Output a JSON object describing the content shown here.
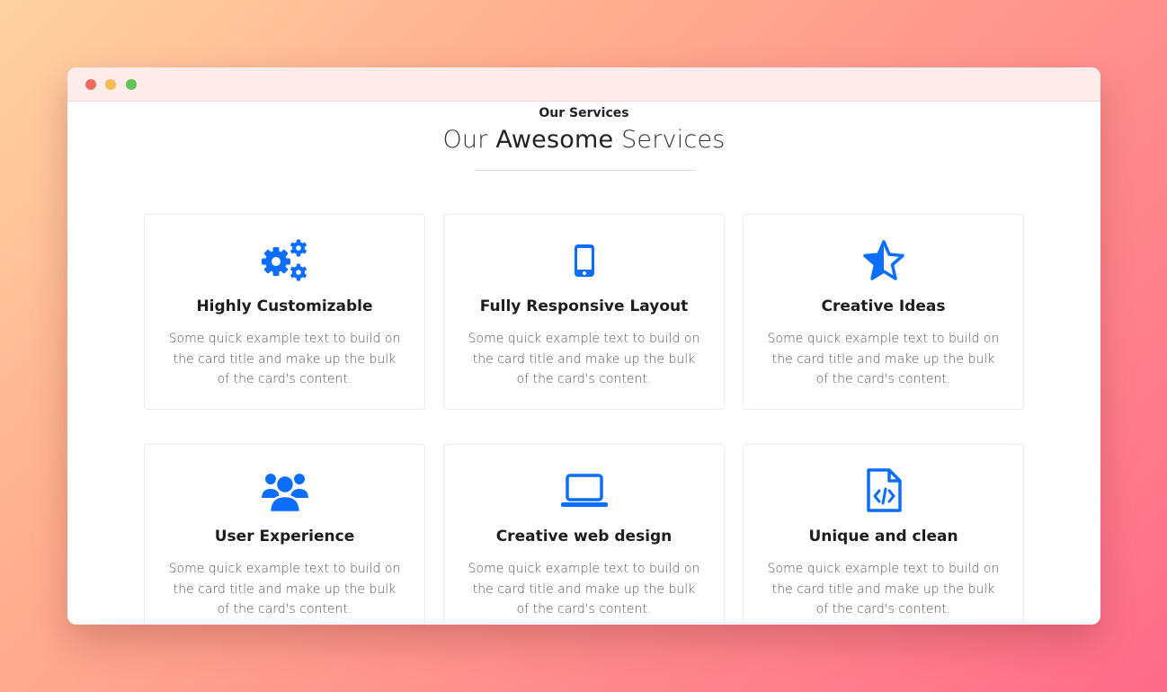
{
  "window": {
    "controls": [
      "close",
      "minimize",
      "maximize"
    ]
  },
  "section": {
    "eyebrow": "Our Services",
    "heading_pre": "Our",
    "heading_strong": "Awesome",
    "heading_post": "Services"
  },
  "accent_color": "#0d6efd",
  "cards": [
    {
      "icon": "gears-icon",
      "title": "Highly Customizable",
      "text": "Some quick example text to build on the card title and make up the bulk of the card's content."
    },
    {
      "icon": "mobile-icon",
      "title": "Fully Responsive Layout",
      "text": "Some quick example text to build on the card title and make up the bulk of the card's content."
    },
    {
      "icon": "star-half-icon",
      "title": "Creative Ideas",
      "text": "Some quick example text to build on the card title and make up the bulk of the card's content."
    },
    {
      "icon": "users-icon",
      "title": "User Experience",
      "text": "Some quick example text to build on the card title and make up the bulk of the card's content."
    },
    {
      "icon": "laptop-icon",
      "title": "Creative web design",
      "text": "Some quick example text to build on the card title and make up the bulk of the card's content."
    },
    {
      "icon": "code-file-icon",
      "title": "Unique and clean",
      "text": "Some quick example text to build on the card title and make up the bulk of the card's content."
    }
  ]
}
